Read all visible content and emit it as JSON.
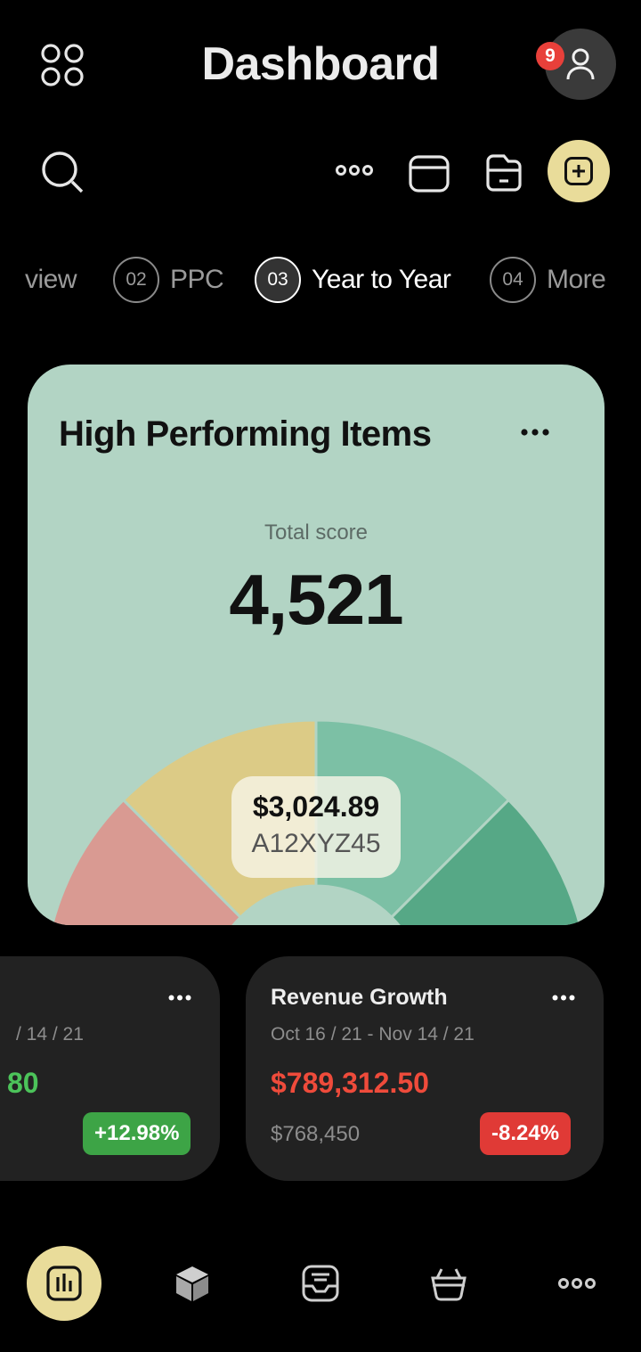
{
  "header": {
    "title": "Dashboard",
    "notification_count": "9"
  },
  "tabs": [
    {
      "num": "",
      "label": "view"
    },
    {
      "num": "02",
      "label": "PPC"
    },
    {
      "num": "03",
      "label": "Year to Year"
    },
    {
      "num": "04",
      "label": "More"
    }
  ],
  "high_performing": {
    "title": "High Performing Items",
    "total_label": "Total score",
    "total_value": "4,521",
    "tooltip_value": "$3,024.89",
    "tooltip_code": "A12XYZ45"
  },
  "gauge_segments": [
    {
      "color": "#d99a92",
      "label": "segment-1"
    },
    {
      "color": "#dccb86",
      "label": "segment-2"
    },
    {
      "color": "#7cc0a5",
      "label": "segment-3"
    },
    {
      "color": "#56a886",
      "label": "segment-4"
    }
  ],
  "cards": [
    {
      "title": "",
      "date": "/ 14 / 21",
      "value": "80",
      "previous": "",
      "change": "+12.98%"
    },
    {
      "title": "Revenue Growth",
      "date": "Oct 16 / 21 - Nov 14 / 21",
      "value": "$789,312.50",
      "previous": "$768,450",
      "change": "-8.24%"
    }
  ],
  "colors": {
    "accent": "#e9dc9a",
    "card_bg": "#b2d4c4",
    "positive": "#3da446",
    "negative": "#e03a36",
    "negative_value": "#ef4b3b",
    "positive_value": "#4cc35a"
  },
  "nav": [
    "chart-icon",
    "package-icon",
    "inbox-icon",
    "basket-icon",
    "more-icon"
  ]
}
